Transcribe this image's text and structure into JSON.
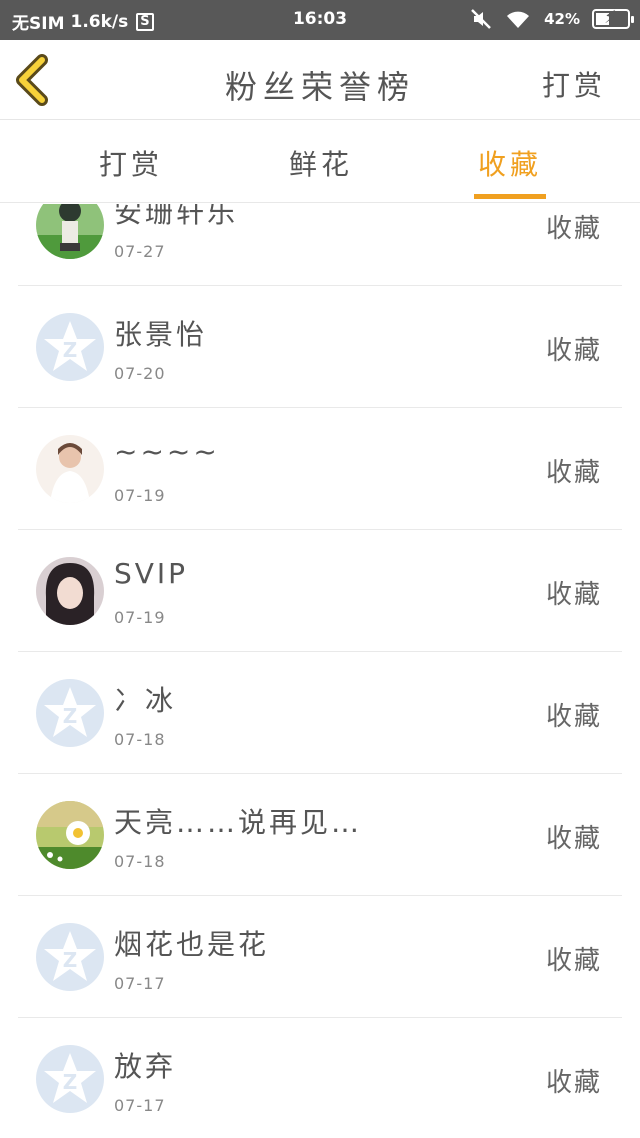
{
  "statusbar": {
    "carrier": "无SIM",
    "speed": "1.6k/s",
    "s_badge": "S",
    "time": "16:03",
    "battery": "42%",
    "battery_level": 0.42
  },
  "header": {
    "title": "粉丝荣誉榜",
    "right_label": "打赏"
  },
  "tabs": [
    {
      "label": "打赏",
      "active": false
    },
    {
      "label": "鲜花",
      "active": false
    },
    {
      "label": "收藏",
      "active": true
    }
  ],
  "list": [
    {
      "name": "安珊轩乐",
      "date": "07-27",
      "action": "收藏",
      "avatar": "photo-anime"
    },
    {
      "name": "张景怡",
      "date": "07-20",
      "action": "收藏",
      "avatar": "default-qzone"
    },
    {
      "name": "~~~~",
      "date": "07-19",
      "action": "收藏",
      "avatar": "photo-girl-white"
    },
    {
      "name": "SVIP",
      "date": "07-19",
      "action": "收藏",
      "avatar": "photo-girl"
    },
    {
      "name": "冫冰",
      "date": "07-18",
      "action": "收藏",
      "avatar": "default-qzone"
    },
    {
      "name": "天亮……说再见…",
      "date": "07-18",
      "action": "收藏",
      "avatar": "photo-daisy"
    },
    {
      "name": "烟花也是花",
      "date": "07-17",
      "action": "收藏",
      "avatar": "default-qzone"
    },
    {
      "name": "放弃",
      "date": "07-17",
      "action": "收藏",
      "avatar": "default-qzone"
    }
  ],
  "colors": {
    "accent": "#f0a020",
    "statusbar": "#585858",
    "default_avatar": "#dce6f2"
  }
}
